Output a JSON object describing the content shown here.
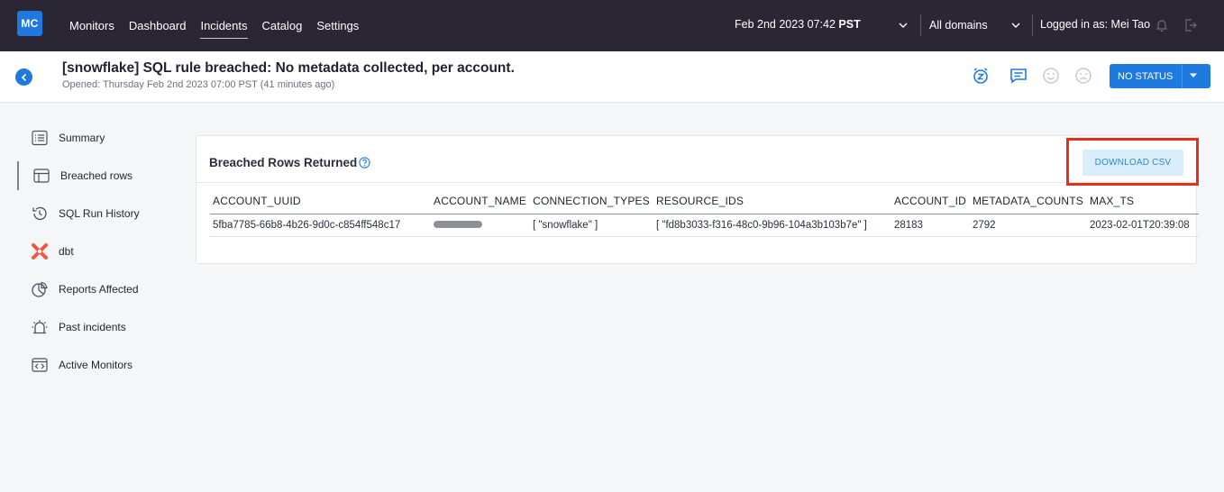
{
  "topbar": {
    "logo": "MC",
    "nav": [
      "Monitors",
      "Dashboard",
      "Incidents",
      "Catalog",
      "Settings"
    ],
    "active_nav": "Incidents",
    "date": "Feb 2nd 2023 07:42",
    "timezone": "PST",
    "domain": "All domains",
    "user": "Logged in as: Mei Tao"
  },
  "header": {
    "title": "[snowflake] SQL rule breached: No metadata collected, per account.",
    "subtitle": "Opened: Thursday Feb 2nd 2023 07:00 PST (41 minutes ago)",
    "status_button": "NO STATUS",
    "icons": [
      "snooze-icon",
      "comment-icon",
      "happy-face-icon",
      "sad-face-icon"
    ]
  },
  "sidebar": {
    "items": [
      {
        "label": "Summary",
        "icon": "list-icon"
      },
      {
        "label": "Breached rows",
        "icon": "table-icon",
        "active": true
      },
      {
        "label": "SQL Run History",
        "icon": "history-icon"
      },
      {
        "label": "dbt",
        "icon": "dbt-icon"
      },
      {
        "label": "Reports Affected",
        "icon": "pie-chart-icon"
      },
      {
        "label": "Past incidents",
        "icon": "alarm-icon"
      },
      {
        "label": "Active Monitors",
        "icon": "code-window-icon"
      }
    ]
  },
  "card": {
    "title": "Breached Rows Returned",
    "download_label": "DOWNLOAD CSV",
    "columns": [
      "ACCOUNT_UUID",
      "ACCOUNT_NAME",
      "CONNECTION_TYPES",
      "RESOURCE_IDS",
      "ACCOUNT_ID",
      "METADATA_COUNTS",
      "MAX_TS"
    ],
    "rows": [
      [
        "5fba7785-66b8-4b26-9d0c-c854ff548c17",
        "",
        "[ \"snowflake\" ]",
        "[ \"fd8b3033-f316-48c0-9b96-104a3b103b7e\" ]",
        "28183",
        "2792",
        "2023-02-01T20:39:08"
      ]
    ]
  },
  "colors": {
    "accent": "#1f7ae0",
    "topbar": "#2a2633",
    "highlight": "#e0301e"
  }
}
